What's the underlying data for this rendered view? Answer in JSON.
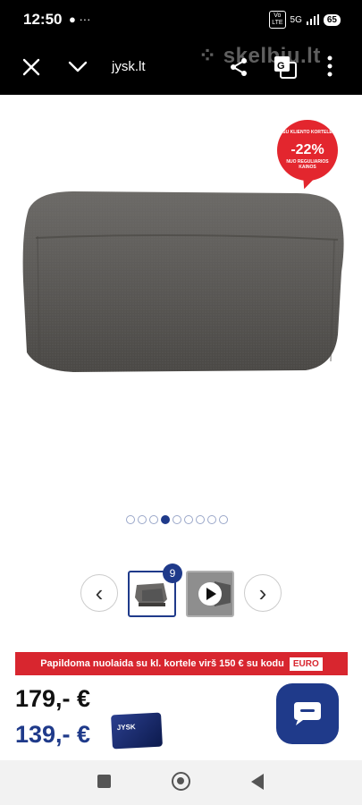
{
  "status_bar": {
    "time": "12:50",
    "left_icons": "● ···",
    "volte_label": "Vo\nLTE",
    "network_label": "5G",
    "battery": "65"
  },
  "browser": {
    "url": "jysk.lt",
    "watermark": "⁘ skelbiu.lt",
    "icons": [
      "close-icon",
      "chevron-down-icon",
      "share-icon",
      "translate-icon",
      "more-vertical-icon"
    ]
  },
  "badge": {
    "top_text": "SU KLIENTO KORTELE",
    "percent": "-22%",
    "bottom_text": "NUO REGULIARIOS KAINOS",
    "color": "#e3262e"
  },
  "gallery": {
    "total_images": "9",
    "dots_count": 9,
    "active_dot_index": 3,
    "prev_symbol": "‹",
    "next_symbol": "›"
  },
  "promo": {
    "text": "Papildoma nuolaida su kl. kortele virš 150 € su kodu",
    "code": "EURO",
    "color": "#d8262f"
  },
  "prices": {
    "old": "179,- €",
    "new": "139,- €",
    "card_label": "JYSK",
    "accent": "#1f3a8a"
  }
}
